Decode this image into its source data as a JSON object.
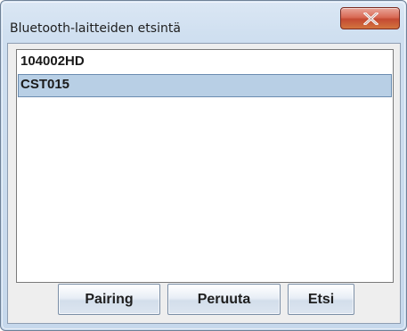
{
  "window": {
    "title": "Bluetooth-laitteiden etsintä"
  },
  "titlebar": {
    "close_icon": "close-x-icon",
    "close_button_color": "#c9523b"
  },
  "device_list": {
    "items": [
      {
        "label": "104002HD",
        "selected": false
      },
      {
        "label": "CST015",
        "selected": true
      }
    ],
    "selection_color": "#b8cfe5"
  },
  "buttons": {
    "pairing_label": "Pairing",
    "cancel_label": "Peruuta",
    "search_label": "Etsi"
  }
}
